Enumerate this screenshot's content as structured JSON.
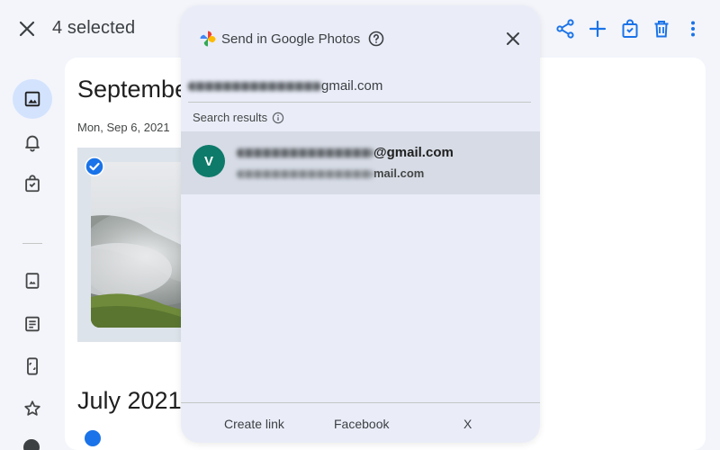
{
  "topbar": {
    "selected_text": "4 selected",
    "actions": [
      "share-icon",
      "add-icon",
      "shopping-bag-icon",
      "trash-icon",
      "more-vert-icon"
    ]
  },
  "rail": {
    "items": [
      "photos-icon",
      "bell-icon",
      "shopping-bag-icon",
      "album-icon",
      "document-icon",
      "phone-icon",
      "star-icon"
    ],
    "active_color": "#d3e3fd"
  },
  "content": {
    "month_title": "Septembe",
    "day_label": "Mon, Sep 6, 2021",
    "second_month_title": "July 2021"
  },
  "share_sheet": {
    "title": "Send in Google Photos",
    "recipient": {
      "visible_part": "gmail.com"
    },
    "results_label": "Search results",
    "result": {
      "avatar_letter": "V",
      "avatar_color": "#0e7a6a",
      "name_visible": "@gmail.com",
      "email_visible": "mail.com"
    },
    "footer": {
      "create_link": "Create link",
      "facebook": "Facebook",
      "x": "X"
    }
  },
  "colors": {
    "accent": "#1a73e8",
    "sheet_bg": "#eaedf8",
    "row_highlight": "#d6dbe5"
  }
}
